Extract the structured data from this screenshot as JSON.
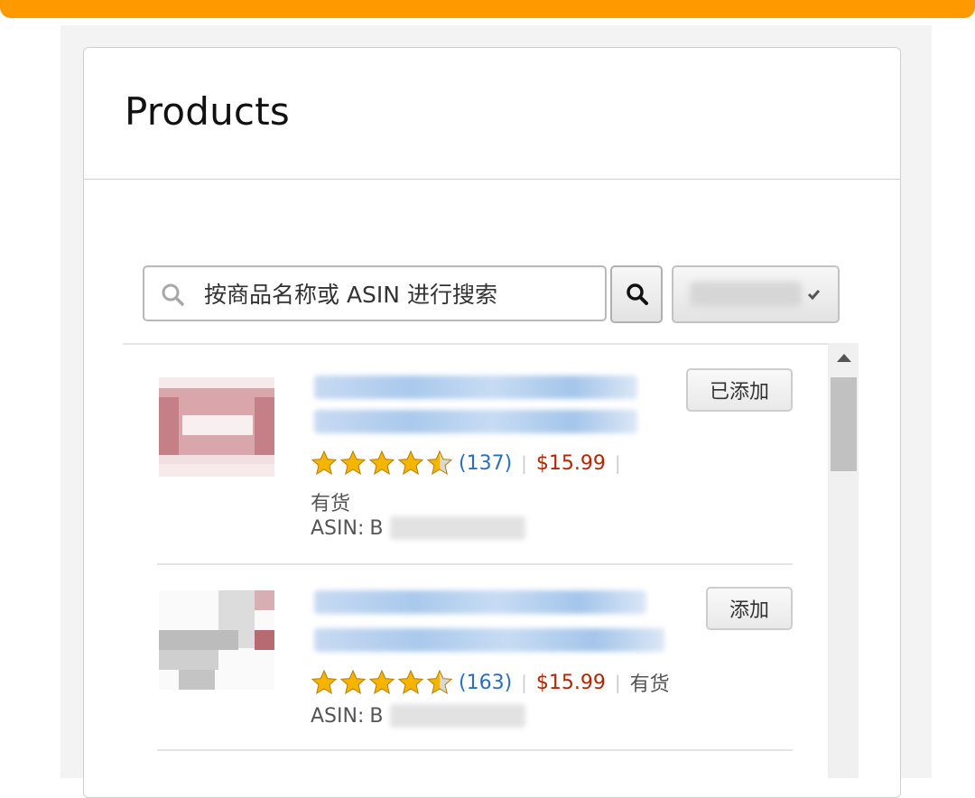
{
  "panel": {
    "title": "Products"
  },
  "search": {
    "placeholder": "按商品名称或 ASIN 进行搜索"
  },
  "products": [
    {
      "review_count": "(137)",
      "price": "$15.99",
      "stock": "有货",
      "asin_label": "ASIN:",
      "asin_prefix": "B",
      "action_label": "已添加",
      "rating": 4.5
    },
    {
      "review_count": "(163)",
      "price": "$15.99",
      "stock": "有货",
      "asin_label": "ASIN:",
      "asin_prefix": "B",
      "action_label": "添加",
      "rating": 4.5
    }
  ],
  "colors": {
    "accent": "#ff9900",
    "price": "#b12704",
    "link": "#2a6fbf"
  }
}
